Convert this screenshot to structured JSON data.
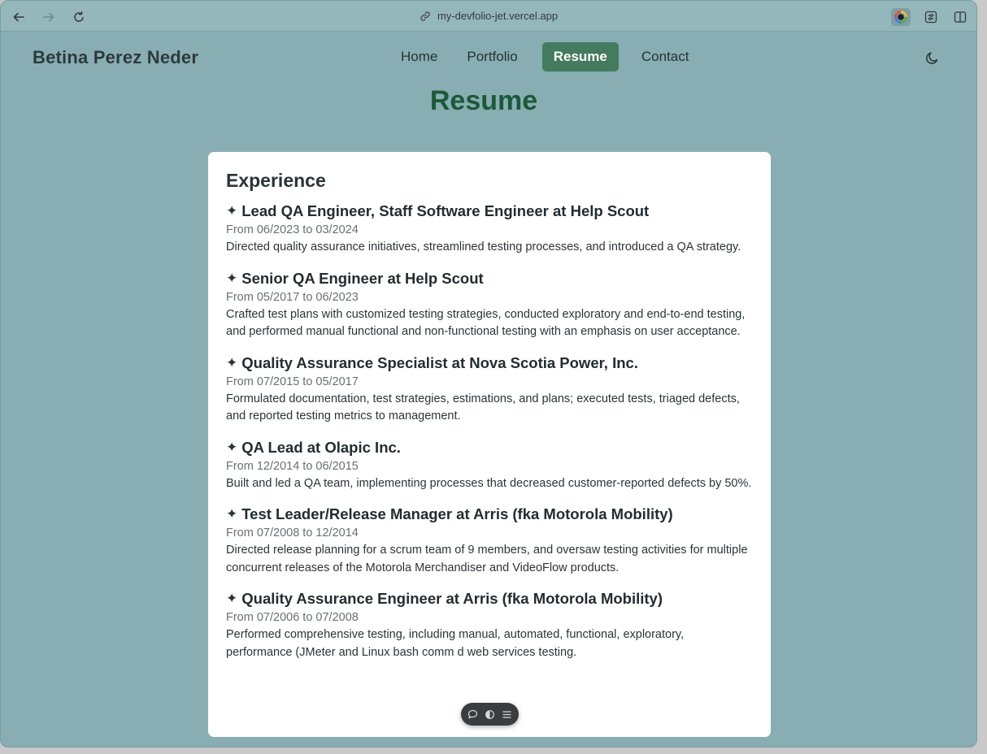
{
  "browser": {
    "url": "my-devfolio-jet.vercel.app"
  },
  "header": {
    "brand": "Betina Perez Neder",
    "nav": [
      {
        "label": "Home"
      },
      {
        "label": "Portfolio"
      },
      {
        "label": "Resume",
        "active": true
      },
      {
        "label": "Contact"
      }
    ]
  },
  "page": {
    "title": "Resume",
    "section_title": "Experience"
  },
  "jobs": [
    {
      "title": "Lead QA Engineer, Staff Software Engineer at Help Scout",
      "dates": "From 06/2023 to 03/2024",
      "desc": "Directed quality assurance initiatives, streamlined testing processes, and introduced a QA strategy."
    },
    {
      "title": "Senior QA Engineer at Help Scout",
      "dates": "From 05/2017 to 06/2023",
      "desc": "Crafted test plans with customized testing strategies, conducted exploratory and end-to-end testing, and performed manual functional and non-functional testing with an emphasis on user acceptance."
    },
    {
      "title": "Quality Assurance Specialist at Nova Scotia Power, Inc.",
      "dates": "From 07/2015 to 05/2017",
      "desc": "Formulated documentation, test strategies, estimations, and plans; executed tests, triaged defects, and reported testing metrics to management."
    },
    {
      "title": "QA Lead at Olapic Inc.",
      "dates": "From 12/2014 to 06/2015",
      "desc": "Built and led a QA team, implementing processes that decreased customer-reported defects by 50%."
    },
    {
      "title": "Test Leader/Release Manager at Arris (fka Motorola Mobility)",
      "dates": "From 07/2008 to 12/2014",
      "desc": "Directed release planning for a scrum team of 9 members, and oversaw testing activities for multiple concurrent releases of the Motorola Merchandiser and VideoFlow products."
    },
    {
      "title": "Quality Assurance Engineer at Arris (fka Motorola Mobility)",
      "dates": "From 07/2006 to 07/2008",
      "desc": "Performed comprehensive testing, including manual, automated, functional, exploratory, performance (JMeter and Linux bash comm         d web services testing."
    }
  ],
  "colors": {
    "background": "#88aeb4",
    "accent": "#447a5e",
    "title": "#1b5a38"
  },
  "icons": {
    "back": "arrow-left-icon",
    "forward": "arrow-right-icon",
    "reload": "reload-icon",
    "link": "link-icon",
    "theme": "moon-icon"
  }
}
